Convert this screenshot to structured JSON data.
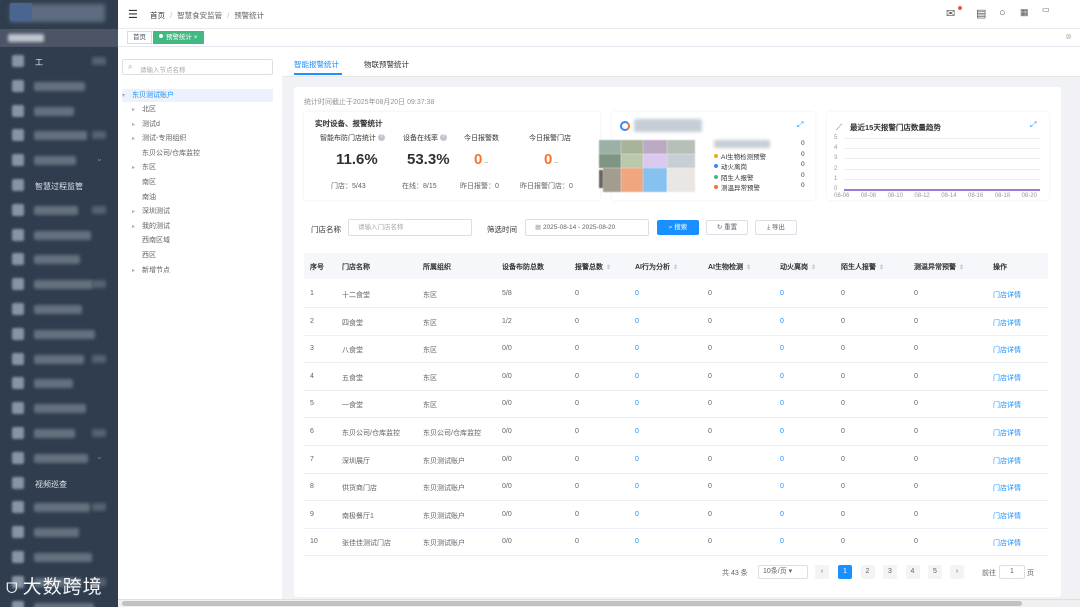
{
  "sidebar": {
    "items": [
      {
        "label": "工",
        "blurred_extra": true
      },
      {
        "label": ""
      },
      {
        "label": ""
      },
      {
        "label": ""
      },
      {
        "label": ""
      },
      {
        "label": "智慧过程监管"
      },
      {
        "label": ""
      },
      {
        "label": ""
      },
      {
        "label": ""
      },
      {
        "label": ""
      },
      {
        "label": ""
      },
      {
        "label": ""
      },
      {
        "label": ""
      },
      {
        "label": ""
      },
      {
        "label": ""
      },
      {
        "label": ""
      },
      {
        "label": ""
      },
      {
        "label": "视频巡查"
      },
      {
        "label": ""
      },
      {
        "label": ""
      },
      {
        "label": ""
      },
      {
        "label": ""
      },
      {
        "label": ""
      }
    ]
  },
  "watermark": {
    "logo": "ᗜ",
    "text": "大数跨境"
  },
  "header": {
    "breadcrumb": [
      "首页",
      "智慧食安监管",
      "预警统计"
    ]
  },
  "tags": {
    "home": "首页",
    "active": "预警统计"
  },
  "tree": {
    "placeholder": "请输入节点名称",
    "root": "东贝测试账户",
    "nodes": [
      {
        "label": "北区",
        "arrow": true
      },
      {
        "label": "测试d",
        "arrow": true
      },
      {
        "label": "测试-专用组织",
        "arrow": true
      },
      {
        "label": "东贝公司/仓库监控",
        "arrow": false
      },
      {
        "label": "东区",
        "arrow": true
      },
      {
        "label": "南区",
        "arrow": false
      },
      {
        "label": "南油",
        "arrow": false
      },
      {
        "label": "深圳测试",
        "arrow": true
      },
      {
        "label": "我的测试",
        "arrow": true
      },
      {
        "label": "西南区域",
        "arrow": false
      },
      {
        "label": "西区",
        "arrow": false
      },
      {
        "label": "新增节点",
        "arrow": true
      }
    ]
  },
  "main": {
    "tabs": [
      "智能报警统计",
      "物联预警统计"
    ],
    "stat_time": "统计时间截止于2025年08月20日 09:37:38",
    "realtime_title": "实时设备、报警统计",
    "kpis": [
      {
        "head": "智能布防门店统计",
        "help": "?",
        "value": "11.6%",
        "dash": "",
        "sub": "门店：5/43",
        "orange": false
      },
      {
        "head": "设备在线率",
        "help": "?",
        "value": "53.3%",
        "dash": "",
        "sub": "在线：8/15",
        "orange": false
      },
      {
        "head": "今日报警数",
        "help": "",
        "value": "0",
        "dash": "–",
        "sub": "昨日报警：0",
        "orange": true
      },
      {
        "head": "今日报警门店",
        "help": "",
        "value": "0",
        "dash": "–",
        "sub": "昨日报警门店：0",
        "orange": true
      }
    ],
    "legend": [
      {
        "label": "",
        "value": "0",
        "color": "#b0b8c8",
        "blurred": true
      },
      {
        "label": "AI生物检测预警",
        "value": "0",
        "color": "#f5a623"
      },
      {
        "label": "动火离岗",
        "value": "0",
        "color": "#3a86ff"
      },
      {
        "label": "陌生人报警",
        "value": "0",
        "color": "#42b983"
      },
      {
        "label": "测温异常预警",
        "value": "0",
        "color": "#f5742e"
      }
    ],
    "trend": {
      "title": "最近15天报警门店数量趋势",
      "yticks": [
        "5",
        "4",
        "3",
        "2",
        "1",
        "0"
      ],
      "xticks": [
        "08-06",
        "08-08",
        "08-10",
        "08-12",
        "08-14",
        "08-16",
        "08-18",
        "08-20"
      ]
    },
    "filter": {
      "store_label": "门店名称",
      "store_placeholder": "请输入门店名称",
      "time_label": "筛选时间",
      "date_range": "2025-08-14  -  2025-08-20",
      "search": "搜索",
      "reset": "重置",
      "export": "导出"
    },
    "table": {
      "headers": [
        "序号",
        "门店名称",
        "所属组织",
        "设备布防总数",
        "报警总数",
        "AI行为分析",
        "AI生物检测",
        "动火离岗",
        "陌生人报警",
        "测温异常预警",
        "操作"
      ],
      "rows": [
        [
          "1",
          "十二食堂",
          "东区",
          "5/8",
          "0",
          "0",
          "0",
          "0",
          "0",
          "0",
          "门店详情"
        ],
        [
          "2",
          "四食堂",
          "东区",
          "1/2",
          "0",
          "0",
          "0",
          "0",
          "0",
          "0",
          "门店详情"
        ],
        [
          "3",
          "八食堂",
          "东区",
          "0/0",
          "0",
          "0",
          "0",
          "0",
          "0",
          "0",
          "门店详情"
        ],
        [
          "4",
          "五食堂",
          "东区",
          "0/0",
          "0",
          "0",
          "0",
          "0",
          "0",
          "0",
          "门店详情"
        ],
        [
          "5",
          "一食堂",
          "东区",
          "0/0",
          "0",
          "0",
          "0",
          "0",
          "0",
          "0",
          "门店详情"
        ],
        [
          "6",
          "东贝公司/仓库监控",
          "东贝公司/仓库监控",
          "0/0",
          "0",
          "0",
          "0",
          "0",
          "0",
          "0",
          "门店详情"
        ],
        [
          "7",
          "深圳展厅",
          "东贝测试账户",
          "0/0",
          "0",
          "0",
          "0",
          "0",
          "0",
          "0",
          "门店详情"
        ],
        [
          "8",
          "供货商门店",
          "东贝测试账户",
          "0/0",
          "0",
          "0",
          "0",
          "0",
          "0",
          "0",
          "门店详情"
        ],
        [
          "9",
          "南极餐厅1",
          "东贝测试账户",
          "0/0",
          "0",
          "0",
          "0",
          "0",
          "0",
          "0",
          "门店详情"
        ],
        [
          "10",
          "张佳佳测试门店",
          "东贝测试账户",
          "0/0",
          "0",
          "0",
          "0",
          "0",
          "0",
          "0",
          "门店详情"
        ]
      ]
    },
    "pagination": {
      "total": "共 43 条",
      "page_size": "10条/页",
      "pages": [
        "1",
        "2",
        "3",
        "4",
        "5"
      ],
      "current": "1",
      "goto_label": "前往",
      "goto_value": "1",
      "page_unit": "页"
    }
  }
}
